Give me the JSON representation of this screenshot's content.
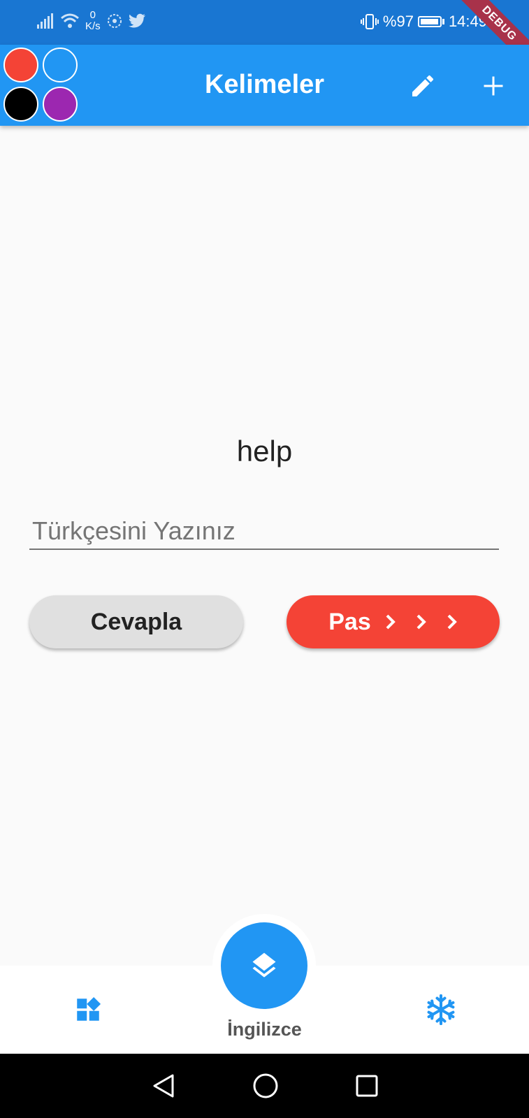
{
  "status_bar": {
    "net_speed_value": "0",
    "net_speed_unit": "K/s",
    "battery_text": "%97",
    "battery_level": 0.97,
    "time": "14:49",
    "debug_banner": "DEBUG"
  },
  "app_bar": {
    "title": "Kelimeler",
    "color_options": [
      "#f44336",
      "#2196f3",
      "#000000",
      "#9c27b0"
    ],
    "edit_icon": "pencil-icon",
    "add_icon": "plus-icon"
  },
  "quiz": {
    "word": "help",
    "input_placeholder": "Türkçesini Yazınız",
    "input_value": "",
    "answer_button": "Cevapla",
    "pass_button": "Pas"
  },
  "bottom_nav": {
    "left_icon": "widgets-icon",
    "center_icon": "layers-icon",
    "center_label": "İngilizce",
    "right_icon": "snowflake-icon"
  },
  "colors": {
    "status_bar": "#1976d2",
    "primary": "#2196f3",
    "pass_button": "#f44336",
    "answer_button": "#e0e0e0"
  }
}
